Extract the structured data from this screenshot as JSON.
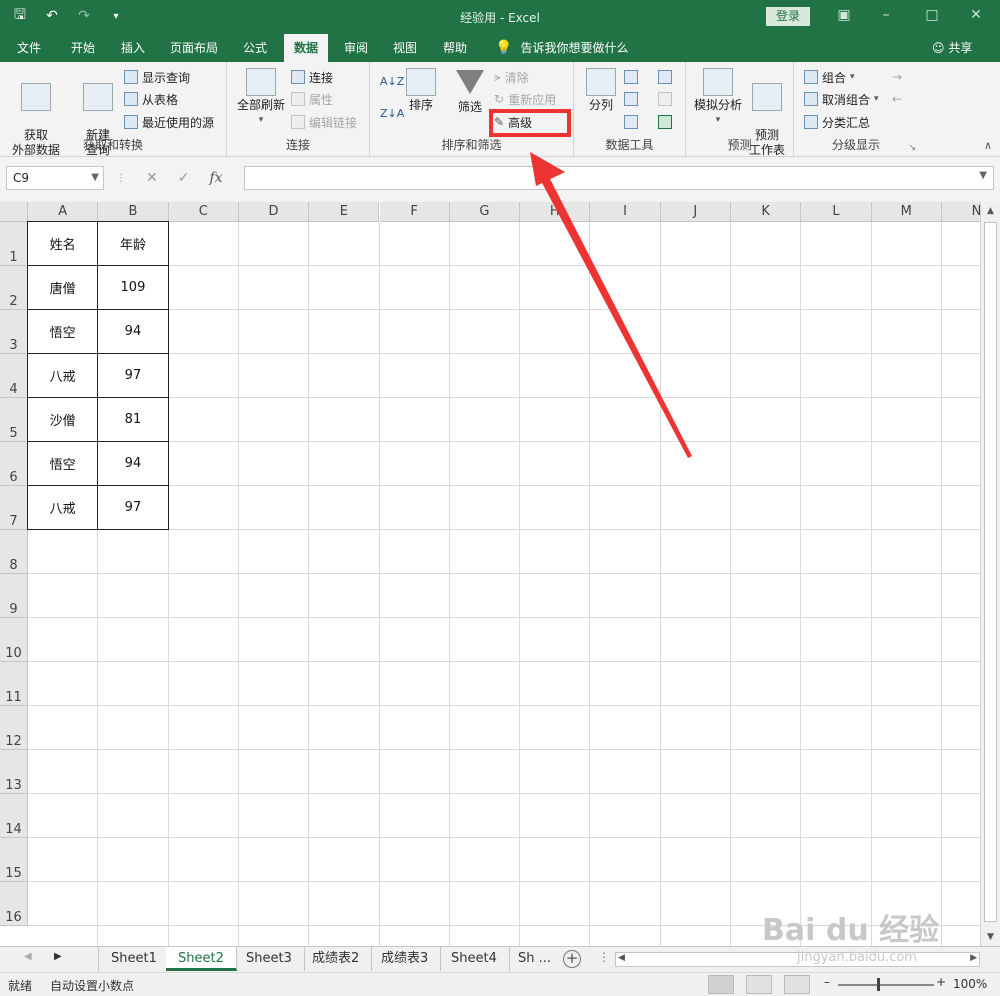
{
  "window": {
    "title": "经验用  -  Excel",
    "login_label": "登录",
    "controls": [
      "restore-ribbon-icon",
      "minimize-icon",
      "maximize-icon",
      "close-icon"
    ]
  },
  "tabs": [
    {
      "label": "文件"
    },
    {
      "label": "开始"
    },
    {
      "label": "插入"
    },
    {
      "label": "页面布局"
    },
    {
      "label": "公式"
    },
    {
      "label": "数据",
      "active": true
    },
    {
      "label": "审阅"
    },
    {
      "label": "视图"
    },
    {
      "label": "帮助"
    }
  ],
  "tell_me": "告诉我你想要做什么",
  "share_label": "共享",
  "ribbon": {
    "get_transform": {
      "group_label": "获取和转换",
      "get_external": "获取\n外部数据",
      "new_query": "新建\n查询",
      "show_queries": "显示查询",
      "from_table": "从表格",
      "recent_sources": "最近使用的源"
    },
    "connections": {
      "group_label": "连接",
      "refresh_all": "全部刷新",
      "connections": "连接",
      "properties": "属性",
      "edit_links": "编辑链接"
    },
    "sort_filter": {
      "group_label": "排序和筛选",
      "sort": "排序",
      "filter": "筛选",
      "clear": "清除",
      "reapply": "重新应用",
      "advanced": "高级"
    },
    "data_tools": {
      "group_label": "数据工具",
      "text_to_columns": "分列"
    },
    "forecast": {
      "group_label": "预测",
      "what_if": "模拟分析",
      "forecast_sheet": "预测\n工作表"
    },
    "outline": {
      "group_label": "分级显示",
      "group": "组合",
      "ungroup": "取消组合",
      "subtotal": "分类汇总"
    }
  },
  "formula_bar": {
    "name_box": "C9",
    "formula": ""
  },
  "columns": [
    "A",
    "B",
    "C",
    "D",
    "E",
    "F",
    "G",
    "H",
    "I",
    "J",
    "K",
    "L",
    "M",
    "N"
  ],
  "rows": [
    "1",
    "2",
    "3",
    "4",
    "5",
    "6",
    "7",
    "8",
    "9",
    "10",
    "11",
    "12",
    "13",
    "14",
    "15",
    "16"
  ],
  "table": {
    "headers": [
      "姓名",
      "年龄"
    ],
    "rows": [
      [
        "唐僧",
        "109"
      ],
      [
        "悟空",
        "94"
      ],
      [
        "八戒",
        "97"
      ],
      [
        "沙僧",
        "81"
      ],
      [
        "悟空",
        "94"
      ],
      [
        "八戒",
        "97"
      ]
    ]
  },
  "sheets": [
    {
      "label": "Sheet1"
    },
    {
      "label": "Sheet2",
      "active": true
    },
    {
      "label": "Sheet3"
    },
    {
      "label": "成绩表2"
    },
    {
      "label": "成绩表3"
    },
    {
      "label": "Sheet4"
    },
    {
      "label": "Sh ..."
    }
  ],
  "status": {
    "ready": "就绪",
    "auto_decimal": "自动设置小数点",
    "zoom": "100%"
  },
  "watermark": {
    "brand": "Bai du 经验",
    "url": "jingyan.baidu.com"
  },
  "colors": {
    "excel_green": "#217346",
    "highlight_red": "#ee3333"
  }
}
